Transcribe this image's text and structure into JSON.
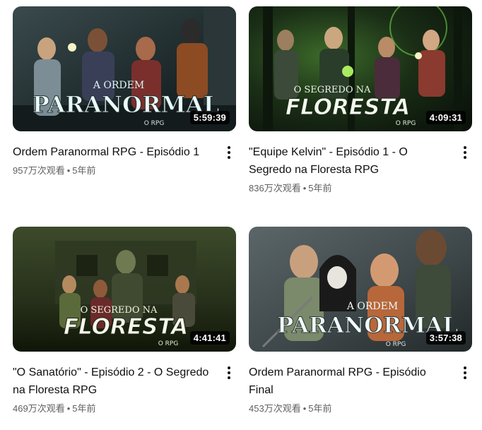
{
  "videos": [
    {
      "title": "Ordem Paranormal RPG - Episódio 1",
      "views": "957万次观看",
      "age": "5年前",
      "duration": "5:59:39",
      "thumb_text_top": "A ORDEM",
      "thumb_text_main": "PARANORMAL",
      "thumb_text_sub": "O RPG"
    },
    {
      "title": "\"Equipe Kelvin\" - Episódio 1 - O Segredo na Floresta RPG",
      "views": "836万次观看",
      "age": "5年前",
      "duration": "4:09:31",
      "thumb_text_top": "O SEGREDO NA",
      "thumb_text_main": "FLORESTA",
      "thumb_text_sub": "O RPG"
    },
    {
      "title": "\"O Sanatório\" - Episódio 2 - O Segredo na Floresta RPG",
      "views": "469万次观看",
      "age": "5年前",
      "duration": "4:41:41",
      "thumb_text_top": "O SEGREDO NA",
      "thumb_text_main": "FLORESTA",
      "thumb_text_sub": "O RPG"
    },
    {
      "title": "Ordem Paranormal RPG - Episódio Final",
      "views": "453万次观看",
      "age": "5年前",
      "duration": "3:57:38",
      "thumb_text_top": "A ORDEM",
      "thumb_text_main": "PARANORMAL",
      "thumb_text_sub": "O RPG"
    }
  ],
  "separator": "•",
  "colors": {
    "title": "#0f0f0f",
    "meta": "#606060",
    "duration_bg": "#000000",
    "floresta_green": "#7dff3a"
  },
  "icons": {
    "more": "vertical-ellipsis-icon"
  }
}
